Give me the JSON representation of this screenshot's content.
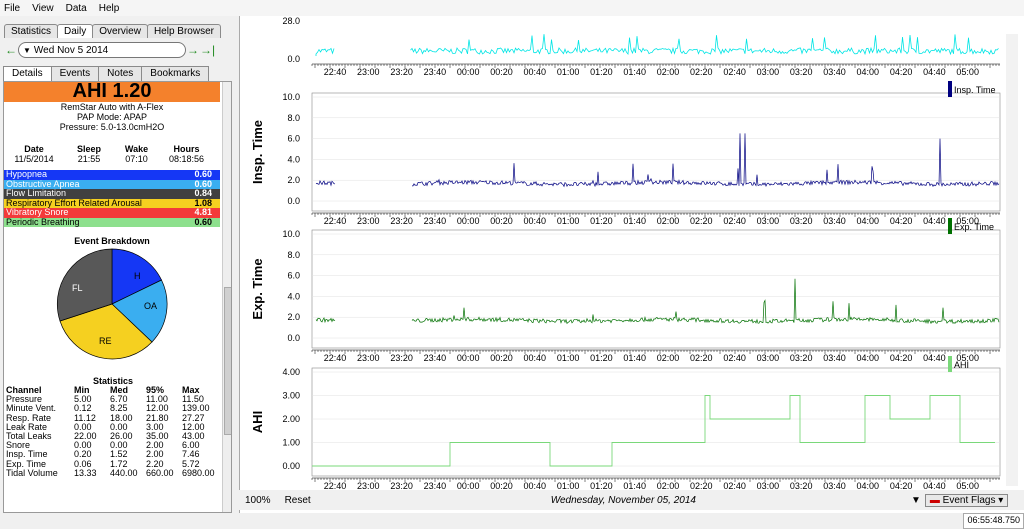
{
  "menu": [
    "File",
    "View",
    "Data",
    "Help"
  ],
  "tabs": [
    "Statistics",
    "Daily",
    "Overview",
    "Help Browser"
  ],
  "date": "Wed Nov 5 2014",
  "subtabs": [
    "Details",
    "Events",
    "Notes",
    "Bookmarks"
  ],
  "ahi": "AHI 1.20",
  "machine": "RemStar Auto with A-Flex",
  "mode": "PAP Mode: APAP",
  "pressure": "Pressure: 5.0-13.0cmH2O",
  "sleep_headers": [
    "Date",
    "Sleep",
    "Wake",
    "Hours"
  ],
  "sleep_values": [
    "11/5/2014",
    "21:55",
    "07:10",
    "08:18:56"
  ],
  "indices": [
    {
      "name": "Hypopnea",
      "value": "0.60",
      "color": "#1537f5"
    },
    {
      "name": "Obstructive Apnea",
      "value": "0.60",
      "color": "#3aaef0"
    },
    {
      "name": "Flow Limitation",
      "value": "0.84",
      "color": "#404040"
    },
    {
      "name": "Respiratory Effort Related Arousal",
      "value": "1.08",
      "color": "#f5d020"
    },
    {
      "name": "Vibratory Snore",
      "value": "4.81",
      "color": "#f33a3a"
    },
    {
      "name": "Periodic Breathing",
      "value": "0.60",
      "color": "#8de08d"
    }
  ],
  "pie_title": "Event Breakdown",
  "pie_labels": [
    "H",
    "OA",
    "RE",
    "FL"
  ],
  "stats": {
    "title": "Statistics",
    "headers": [
      "Channel",
      "Min",
      "Med",
      "95%",
      "Max"
    ],
    "rows": [
      [
        "Pressure",
        "5.00",
        "6.70",
        "11.00",
        "11.50"
      ],
      [
        "Minute Vent.",
        "0.12",
        "8.25",
        "12.00",
        "139.00"
      ],
      [
        "Resp. Rate",
        "11.12",
        "18.00",
        "21.80",
        "27.27"
      ],
      [
        "Leak Rate",
        "0.00",
        "0.00",
        "3.00",
        "12.00"
      ],
      [
        "Total Leaks",
        "22.00",
        "26.00",
        "35.00",
        "43.00"
      ],
      [
        "Snore",
        "0.00",
        "0.00",
        "2.00",
        "6.00"
      ],
      [
        "Insp. Time",
        "0.20",
        "1.52",
        "2.00",
        "7.46"
      ],
      [
        "Exp. Time",
        "0.06",
        "1.72",
        "2.20",
        "5.72"
      ],
      [
        "Tidal Volume",
        "13.33",
        "440.00",
        "660.00",
        "6980.00"
      ]
    ]
  },
  "time_ticks": [
    "22:40",
    "23:00",
    "23:20",
    "23:40",
    "00:00",
    "00:20",
    "00:40",
    "01:00",
    "01:20",
    "01:40",
    "02:00",
    "02:20",
    "02:40",
    "03:00",
    "03:20",
    "03:40",
    "04:00",
    "04:20",
    "04:40",
    "05:00"
  ],
  "charts": [
    {
      "name": "Insp. Time",
      "legend": "Insp. Time",
      "color": "#000080",
      "yticks": [
        "10.0",
        "8.0",
        "6.0",
        "4.0",
        "2.0",
        "0.0"
      ]
    },
    {
      "name": "Exp. Time",
      "legend": "Exp. Time",
      "color": "#007000",
      "yticks": [
        "10.0",
        "8.0",
        "6.0",
        "4.0",
        "2.0",
        "0.0"
      ]
    },
    {
      "name": "AHI",
      "legend": "AHI",
      "color": "#7ad87a",
      "yticks": [
        "4.00",
        "3.00",
        "2.00",
        "1.00",
        "0.00"
      ]
    }
  ],
  "top_chart_yticks": [
    "28.0",
    "0.0"
  ],
  "bottom": {
    "zoom": "100%",
    "reset": "Reset",
    "date_label": "Wednesday, November 05, 2014",
    "flags": "Event Flags"
  },
  "status_time": "06:55:48.750"
}
